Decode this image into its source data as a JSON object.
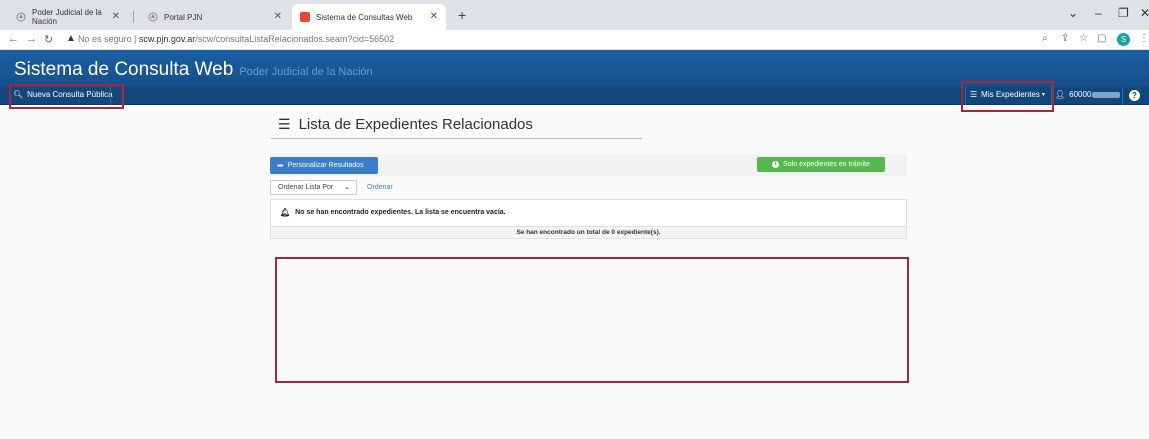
{
  "browser": {
    "tabs": [
      {
        "label": "Poder Judicial de la Nación",
        "icon": "pjn-favicon"
      },
      {
        "label": "Portal PJN",
        "icon": "pjn-favicon"
      },
      {
        "label": "Sistema de Consultas Web",
        "icon": "scw-favicon",
        "active": true
      }
    ],
    "not_secure_label": "No es seguro",
    "url_host": "scw.pjn.gov.ar",
    "url_path": "/scw/consultaListaRelacionados.seam?cid=56502",
    "profile_initial": "S"
  },
  "app": {
    "title": "Sistema de Consulta Web",
    "subtitle": "Poder Judicial de la Nación",
    "nav": {
      "nueva_consulta": "Nueva Consulta Pública",
      "mis_expedientes": "Mis Expedientes",
      "user_prefix": "60000"
    },
    "colors": {
      "header": "#1b5fa2",
      "navbar": "#13467b",
      "primary": "#3c7dc9",
      "success": "#56b84f",
      "annotation": "#a3283f"
    }
  },
  "content": {
    "heading": "Lista de Expedientes Relacionados",
    "personalizar_button": "Personalizar Resultados",
    "tramite_button": "Solo expedientes en trámite",
    "order_select_value": "Ordenar Lista Por",
    "ordenar_link": "Ordenar",
    "empty_message": "No se han encontrado expedientes. La lista se encuentra vacía.",
    "total_message": "Se han encontrado un total de 0 expediente(s)."
  }
}
